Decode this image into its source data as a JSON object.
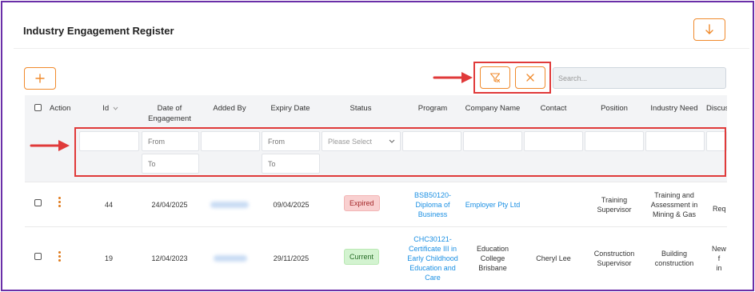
{
  "page": {
    "title": "Industry Engagement Register"
  },
  "toolbar": {
    "download_icon": "arrow-down-icon",
    "add_icon": "plus-icon",
    "filter_icon": "filter-clear-icon",
    "clear_icon": "close-icon",
    "search_placeholder": "Search...",
    "accent_color": "#f08a2c",
    "highlight_color": "#e03a3a"
  },
  "table": {
    "columns": [
      "Action",
      "Id",
      "Date of Engagement",
      "Added By",
      "Expiry Date",
      "Status",
      "Program",
      "Company Name",
      "Contact",
      "Position",
      "Industry Need",
      "Discus"
    ],
    "sort_indicator_column": "Id",
    "filters": {
      "from_placeholder": "From",
      "to_placeholder": "To",
      "select_placeholder": "Please Select"
    },
    "rows": [
      {
        "id": "44",
        "date_of_engagement": "24/04/2025",
        "expiry_date": "09/04/2025",
        "status": "Expired",
        "program": [
          "BSB50120-",
          "Diploma of",
          "Business"
        ],
        "company_name": "Employer Pty Ltd",
        "contact": "",
        "position": [
          "Training",
          "Supervisor"
        ],
        "industry_need": [
          "Training and",
          "Assessment in",
          "Mining & Gas"
        ],
        "discussion": "Req"
      },
      {
        "id": "19",
        "date_of_engagement": "12/04/2023",
        "expiry_date": "29/11/2025",
        "status": "Current",
        "program": [
          "CHC30121-",
          "Certificate III in",
          "Early Childhood",
          "Education and",
          "Care"
        ],
        "company_name": [
          "Education",
          "College",
          "Brisbane"
        ],
        "contact": "Cheryl Lee",
        "position": [
          "Construction",
          "Supervisor"
        ],
        "industry_need": [
          "Building",
          "construction"
        ],
        "discussion": [
          "New",
          "f",
          "in"
        ]
      }
    ]
  }
}
